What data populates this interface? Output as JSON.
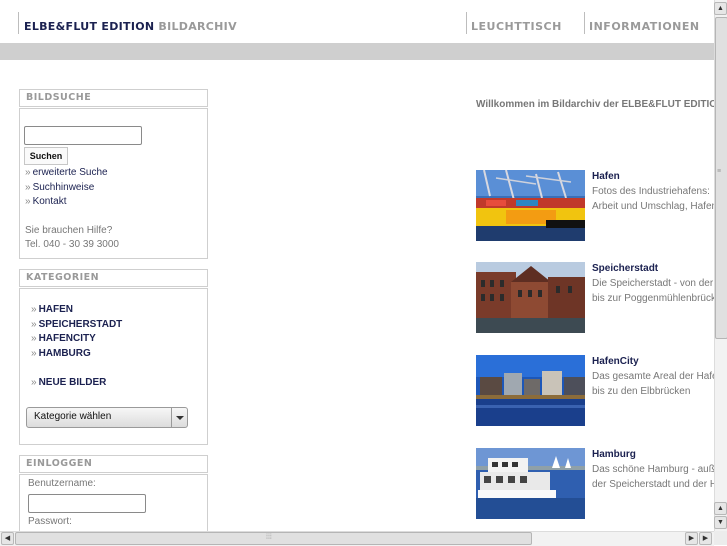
{
  "header": {
    "brand": "ELBE&FLUT EDITION",
    "brand_sub": "BILDARCHIV",
    "nav": [
      "LEUCHTTISCH",
      "INFORMATIONEN"
    ]
  },
  "search": {
    "title": "BILDSUCHE",
    "input_value": "",
    "button": "Suchen",
    "links": [
      "erweiterte Suche",
      "Suchhinweise",
      "Kontakt"
    ],
    "help_question": "Sie brauchen Hilfe?",
    "phone": "Tel. 040 - 30 39 3000"
  },
  "categories": {
    "title": "KATEGORIEN",
    "items": [
      "HAFEN",
      "SPEICHERSTADT",
      "HAFENCITY",
      "HAMBURG"
    ],
    "new_images": "NEUE BILDER",
    "select_value": "Kategorie wählen"
  },
  "login": {
    "title": "EINLOGGEN",
    "username_label": "Benutzername:",
    "username_value": "",
    "password_label": "Passwort:"
  },
  "main": {
    "welcome": "Willkommen im Bildarchiv der ELBE&FLUT EDITION",
    "sections": [
      {
        "title": "Hafen",
        "line1": "Fotos des Industriehafens:",
        "line2": "Arbeit und Umschlag, Hafen"
      },
      {
        "title": "Speicherstadt",
        "line1": "Die Speicherstadt - von der",
        "line2": "bis zur Poggenmühlenbrücke"
      },
      {
        "title": "HafenCity",
        "line1": "Das gesamte Areal der Hafen",
        "line2": "bis zu den Elbbrücken"
      },
      {
        "title": "Hamburg",
        "line1": "Das schöne Hamburg - außer",
        "line2": "der Speicherstadt und der H"
      }
    ]
  },
  "colors": {
    "brand_navy": "#1b2150",
    "grey_text": "#999999",
    "bar_grey": "#cfcfcf"
  }
}
